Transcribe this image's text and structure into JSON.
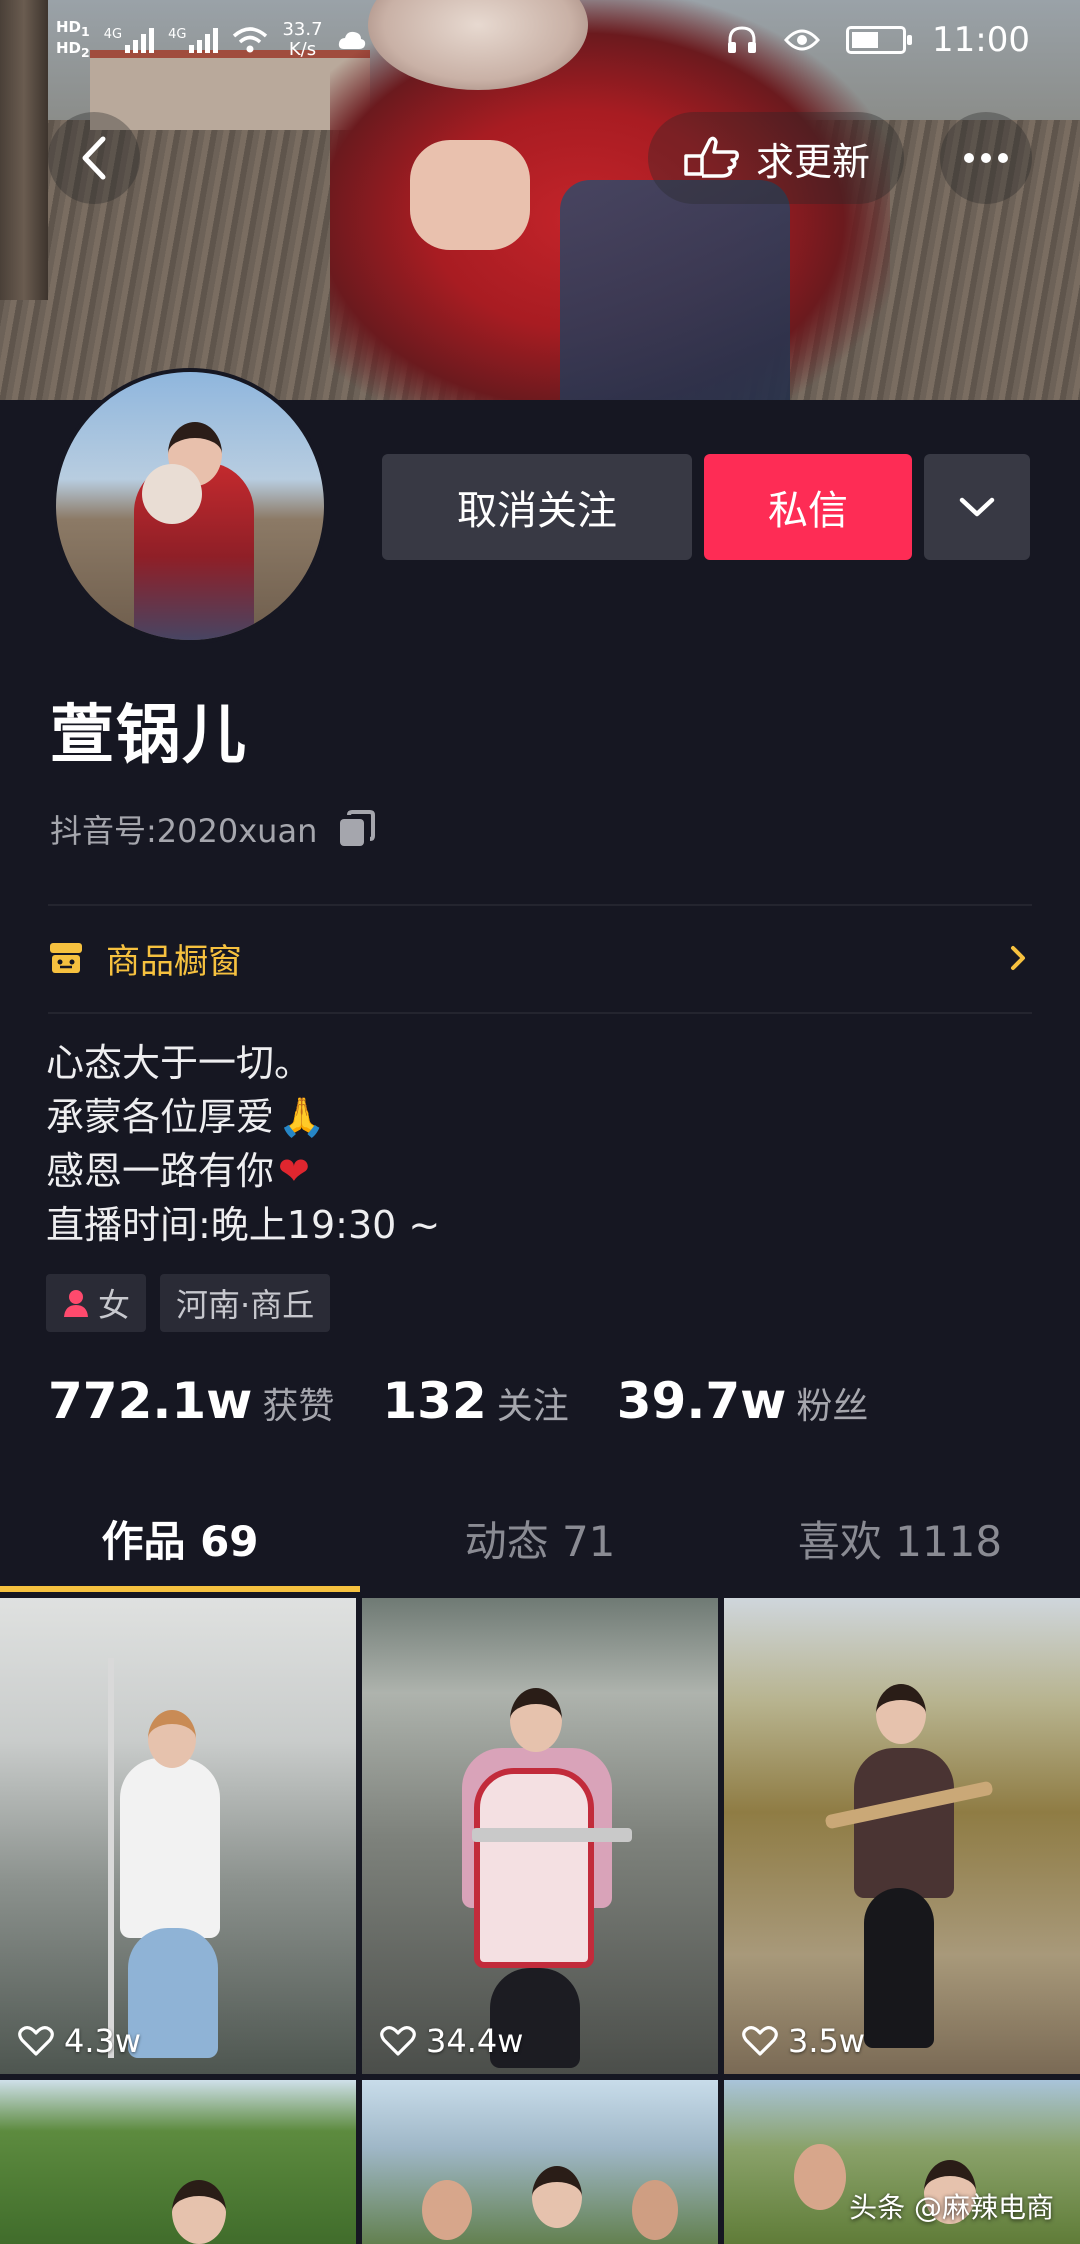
{
  "status_bar": {
    "hd1": "HD",
    "hd1_sub": "1",
    "hd2": "HD",
    "hd2_sub": "2",
    "net1": "4G",
    "net2": "4G",
    "speed_value": "33.7",
    "speed_unit": "K/s",
    "time": "11:00",
    "battery_level": 0.55
  },
  "nav": {
    "update_label": "求更新"
  },
  "actions": {
    "unfollow_label": "取消关注",
    "message_label": "私信"
  },
  "profile": {
    "name": "萱锅儿",
    "id_label": "抖音号:",
    "id_value": "2020xuan"
  },
  "shop": {
    "label": "商品橱窗"
  },
  "bio": {
    "line1": "心态大于一切。",
    "line2": "承蒙各位厚爱",
    "line2_emoji": "🙏",
    "line3": "感恩一路有你",
    "line3_emoji": "❤",
    "line4": "直播时间:晚上19:30 ~"
  },
  "tags": {
    "gender": "女",
    "location": "河南·商丘"
  },
  "stats": {
    "likes_value": "772.1w",
    "likes_label": "获赞",
    "following_value": "132",
    "following_label": "关注",
    "followers_value": "39.7w",
    "followers_label": "粉丝"
  },
  "tabs": [
    {
      "label": "作品 69"
    },
    {
      "label": "动态 71"
    },
    {
      "label": "喜欢 1118"
    }
  ],
  "videos": [
    {
      "likes": "4.3w"
    },
    {
      "likes": "34.4w"
    },
    {
      "likes": "3.5w"
    }
  ],
  "watermark": "头条 @麻辣电商",
  "colors": {
    "background": "#161722",
    "accent_red": "#fe2c55",
    "accent_yellow": "#f6c13f",
    "button_gray": "#383944"
  }
}
